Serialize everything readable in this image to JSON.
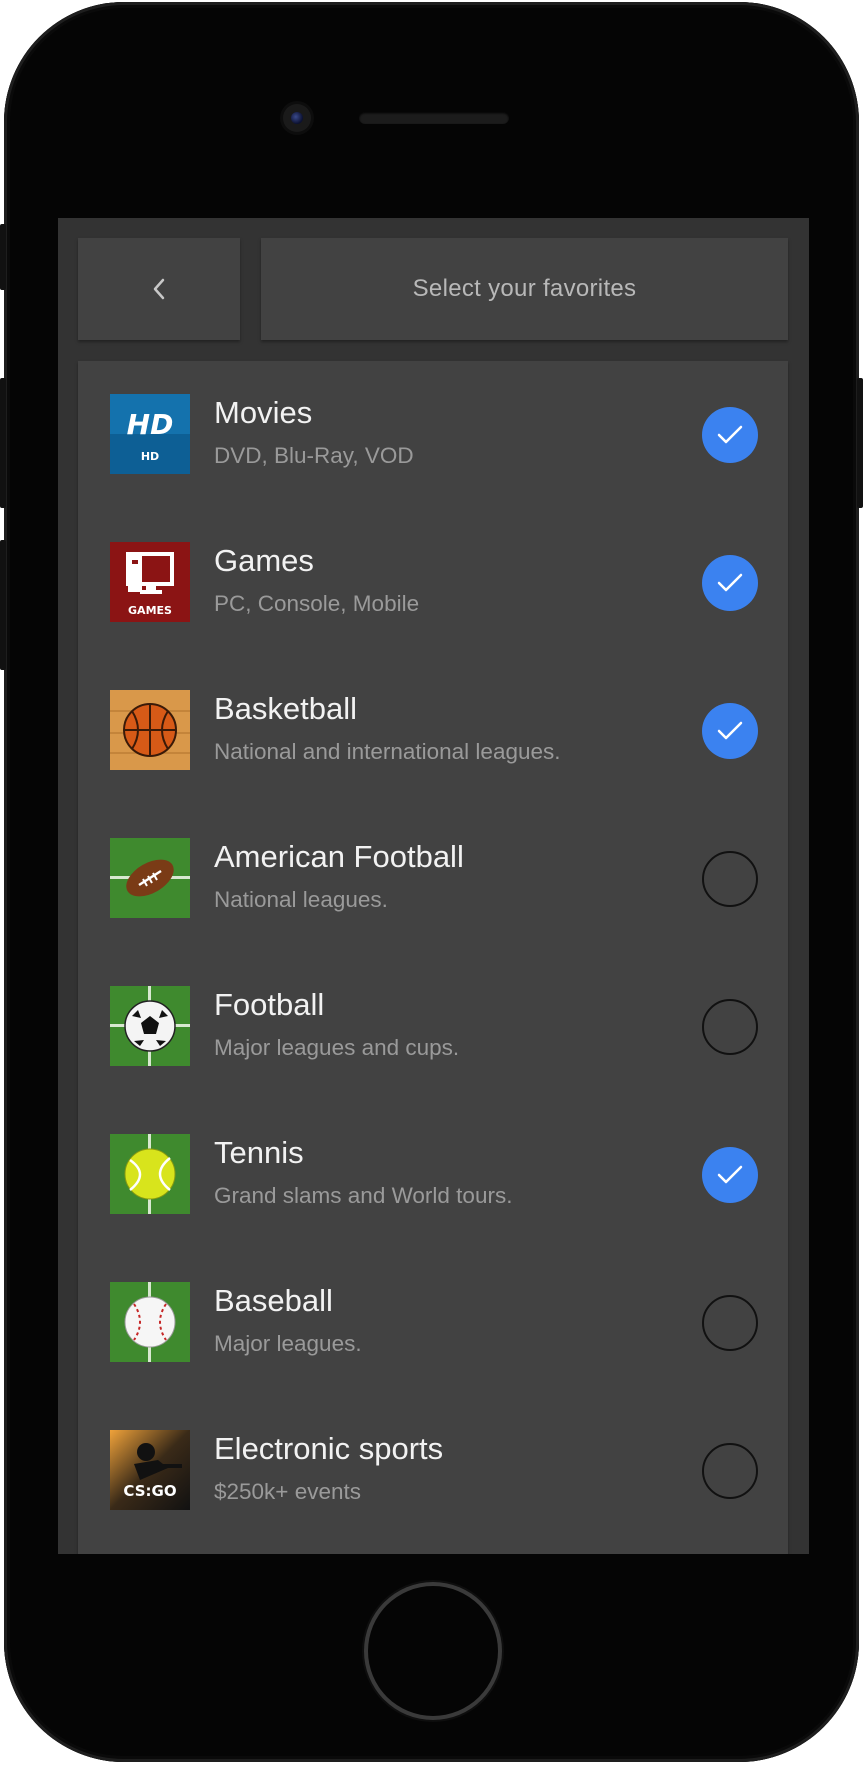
{
  "header": {
    "back_icon": "chevron-left-icon",
    "title": "Select your favorites"
  },
  "colors": {
    "accent": "#3b82f0",
    "screen_bg": "#333333",
    "card_bg": "#424242"
  },
  "categories": [
    {
      "title": "Movies",
      "subtitle": "DVD, Blu-Ray, VOD",
      "icon": "hd-movies-icon",
      "icon_text": "HD",
      "selected": true
    },
    {
      "title": "Games",
      "subtitle": "PC, Console, Mobile",
      "icon": "games-computer-icon",
      "icon_text": "GAMES",
      "selected": true
    },
    {
      "title": "Basketball",
      "subtitle": "National and international leagues.",
      "icon": "basketball-icon",
      "selected": true
    },
    {
      "title": "American Football",
      "subtitle": "National leagues.",
      "icon": "american-football-icon",
      "selected": false
    },
    {
      "title": "Football",
      "subtitle": "Major leagues and cups.",
      "icon": "soccer-ball-icon",
      "selected": false
    },
    {
      "title": "Tennis",
      "subtitle": "Grand slams and World tours.",
      "icon": "tennis-ball-icon",
      "selected": true
    },
    {
      "title": "Baseball",
      "subtitle": "Major leagues.",
      "icon": "baseball-icon",
      "selected": false
    },
    {
      "title": "Electronic sports",
      "subtitle": "$250k+ events",
      "icon": "csgo-icon",
      "icon_text": "CS:GO",
      "selected": false
    }
  ]
}
